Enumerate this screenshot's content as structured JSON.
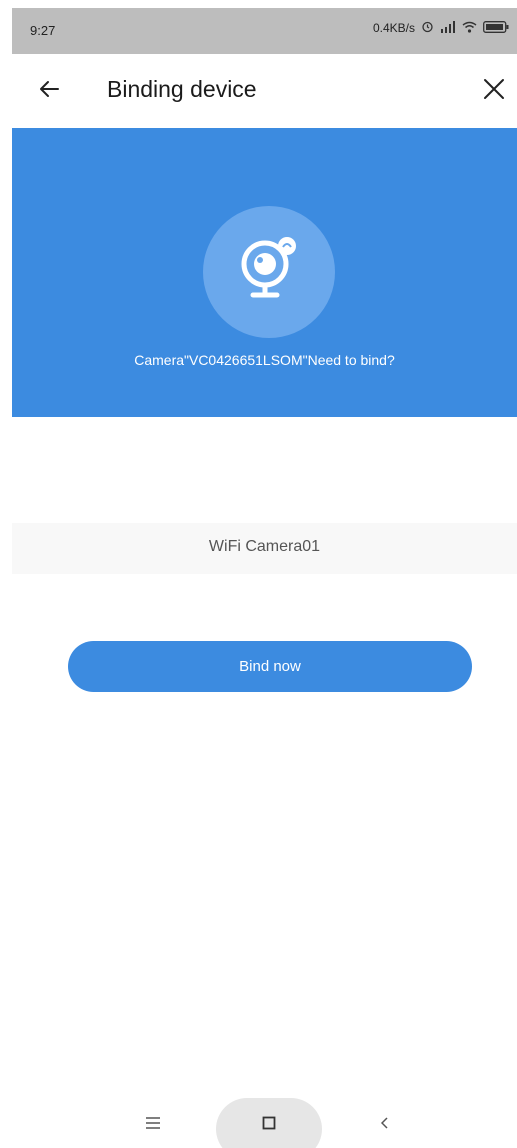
{
  "status_bar": {
    "time": "9:27",
    "network_speed": "0.4KB/s",
    "icons": [
      "alarm-icon",
      "signal-icon",
      "wifi-icon",
      "battery-icon"
    ]
  },
  "app_bar": {
    "title": "Binding device",
    "back_icon": "arrow-left-icon",
    "close_icon": "close-icon"
  },
  "banner": {
    "icon": "webcam-icon",
    "prompt": "Camera\"VC0426651LSOM\"Need to bind?",
    "background_color": "#3c8be0"
  },
  "device": {
    "name": "WiFi Camera01"
  },
  "actions": {
    "bind_label": "Bind now"
  },
  "nav_bar": {
    "menu_icon": "menu-icon",
    "home_icon": "square-icon",
    "back_icon": "chevron-left-icon"
  },
  "colors": {
    "accent": "#3c8be0",
    "status_bar": "#bdbdbd"
  }
}
